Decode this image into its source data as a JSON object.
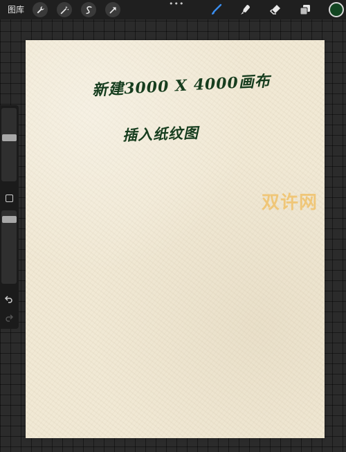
{
  "topbar": {
    "gallery_label": "图库",
    "left_tools": [
      "wrench-icon",
      "magic-wand-icon",
      "selection-icon",
      "transform-arrow-icon"
    ],
    "more_label": "•••",
    "right_tools": [
      "brush-icon",
      "smudge-icon",
      "eraser-icon",
      "layers-icon"
    ],
    "active_tool": "brush-icon",
    "active_tool_color": "#3a8ef0",
    "current_color": "#124521"
  },
  "canvas": {
    "line1": "新建3000 X 4000画布",
    "line2": "插入纸纹图",
    "ink_color": "#163d1e",
    "paper_color": "#f1e9d5"
  },
  "watermark": {
    "text": "双许网",
    "color": "#f1bd5c"
  },
  "sidebar": {
    "controls": [
      "brush-size-slider",
      "modify-button",
      "opacity-slider",
      "undo-icon",
      "redo-icon"
    ]
  }
}
